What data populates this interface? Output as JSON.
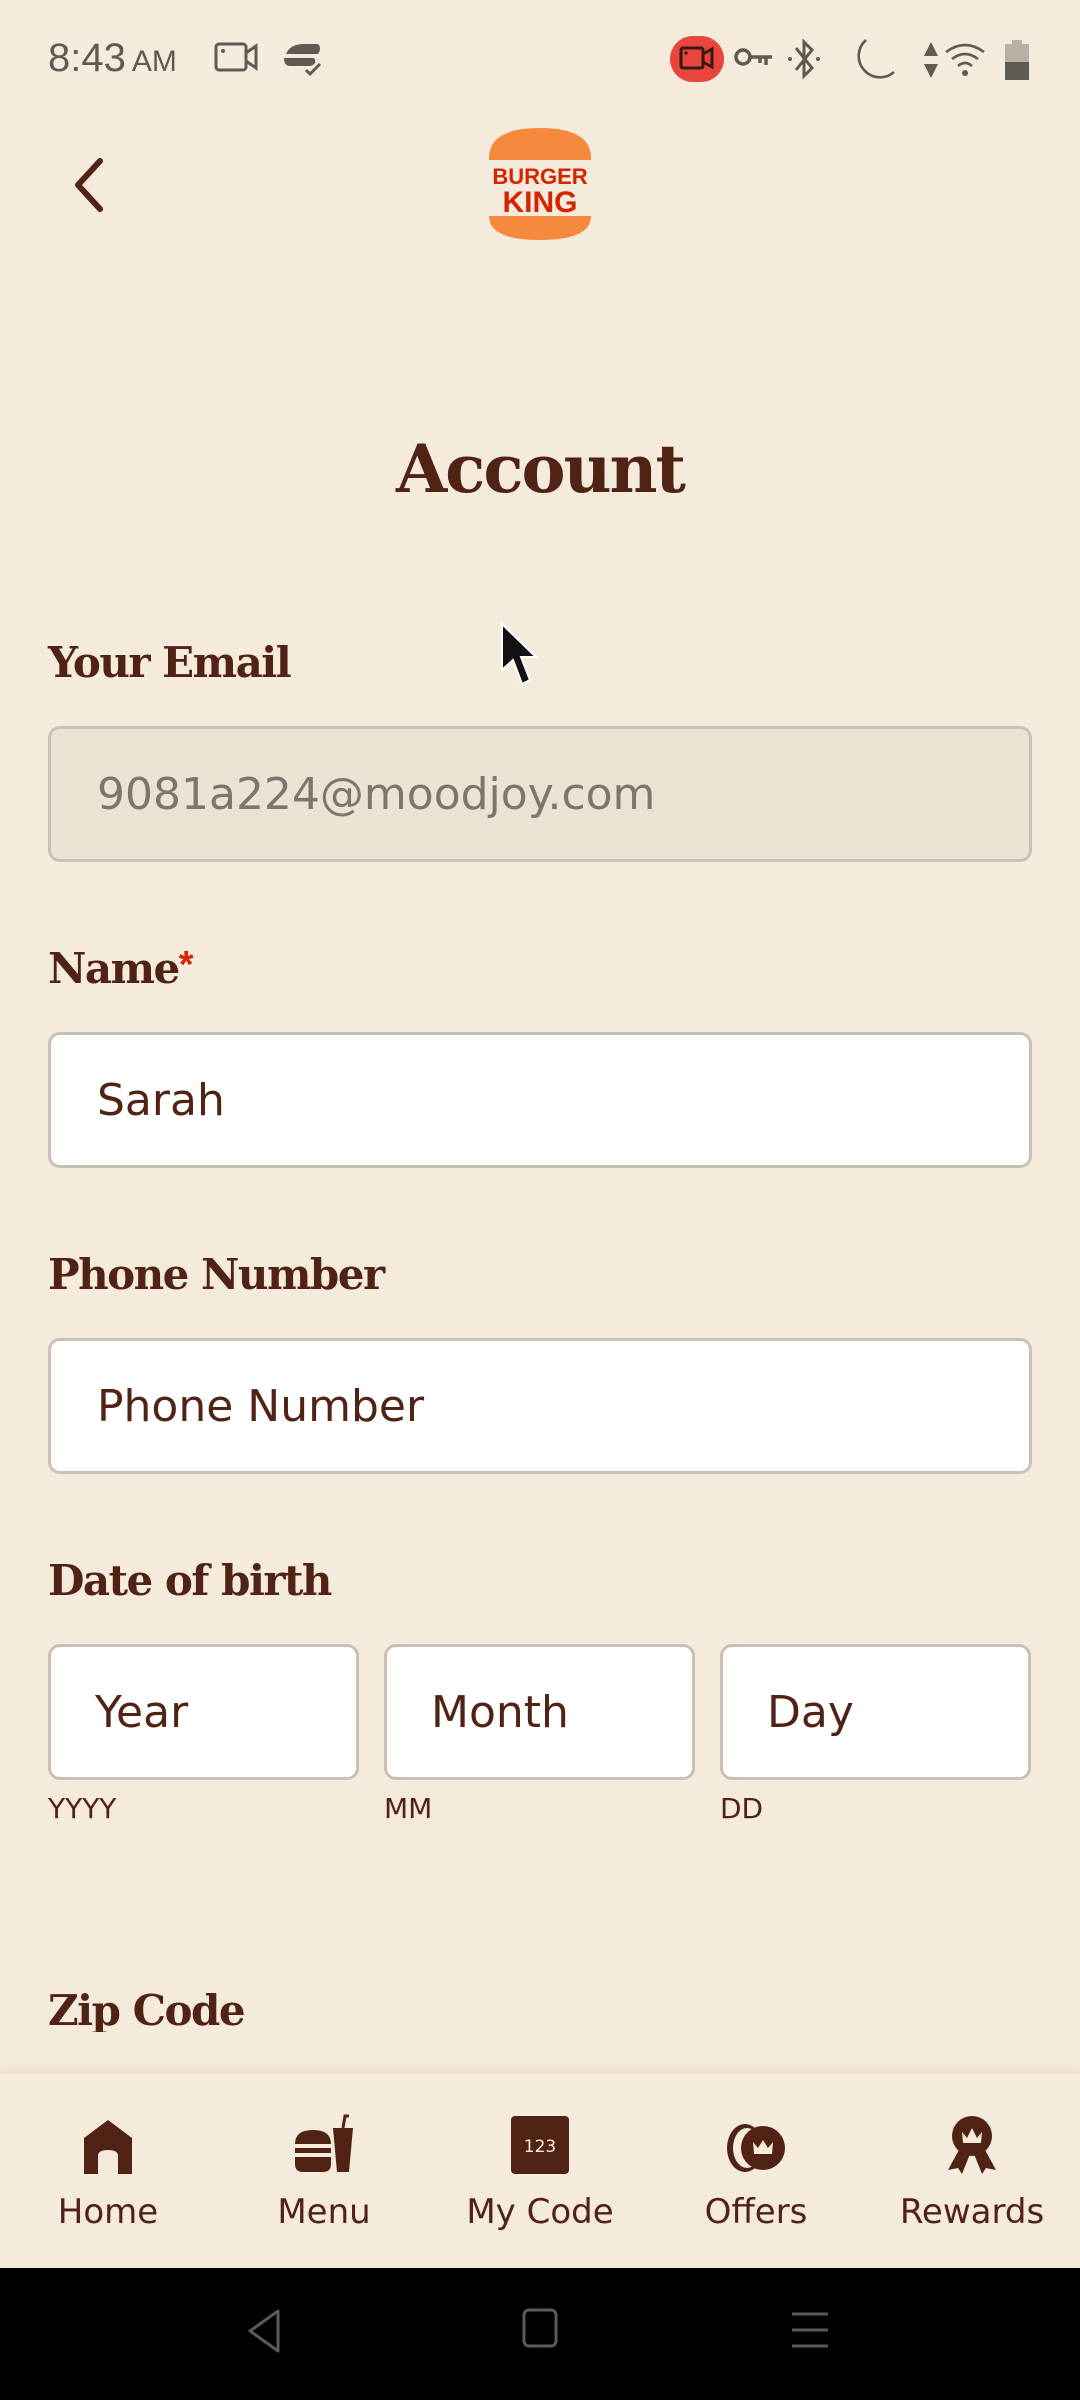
{
  "status_bar": {
    "time": "8:43",
    "ampm": "AM",
    "icons": [
      "screen-record-icon",
      "sync-icon",
      "recording-active-icon",
      "vpn-key-icon",
      "bluetooth-icon",
      "do-not-disturb-moon-icon",
      "data-arrows-icon",
      "wifi-icon",
      "battery-icon"
    ],
    "recording_color": "#e8453c"
  },
  "header": {
    "back_icon": "chevron-left-icon",
    "logo": {
      "line1": "BURGER",
      "line2": "KING",
      "bun_color": "#f5893d",
      "text_color": "#d62300"
    }
  },
  "page": {
    "title": "Account"
  },
  "form": {
    "email": {
      "label": "Your Email",
      "value": "9081a224@moodjoy.com",
      "disabled": true
    },
    "name": {
      "label": "Name",
      "required_mark": "*",
      "value": "Sarah"
    },
    "phone": {
      "label": "Phone Number",
      "placeholder": "Phone Number"
    },
    "dob": {
      "label": "Date of birth",
      "year": {
        "placeholder": "Year",
        "hint": "YYYY"
      },
      "month": {
        "placeholder": "Month",
        "hint": "MM"
      },
      "day": {
        "placeholder": "Day",
        "hint": "DD"
      }
    },
    "zip": {
      "label": "Zip Code"
    }
  },
  "bottom_nav": {
    "items": [
      {
        "label": "Home",
        "icon": "home-icon"
      },
      {
        "label": "Menu",
        "icon": "burger-drink-icon"
      },
      {
        "label": "My Code",
        "icon": "code-123-icon",
        "code_text": "123"
      },
      {
        "label": "Offers",
        "icon": "offers-coins-crown-icon"
      },
      {
        "label": "Rewards",
        "icon": "rewards-ribbon-crown-icon"
      }
    ]
  },
  "colors": {
    "background": "#f5ebdc",
    "brown": "#502314",
    "red": "#d62300",
    "orange": "#f5893d"
  }
}
